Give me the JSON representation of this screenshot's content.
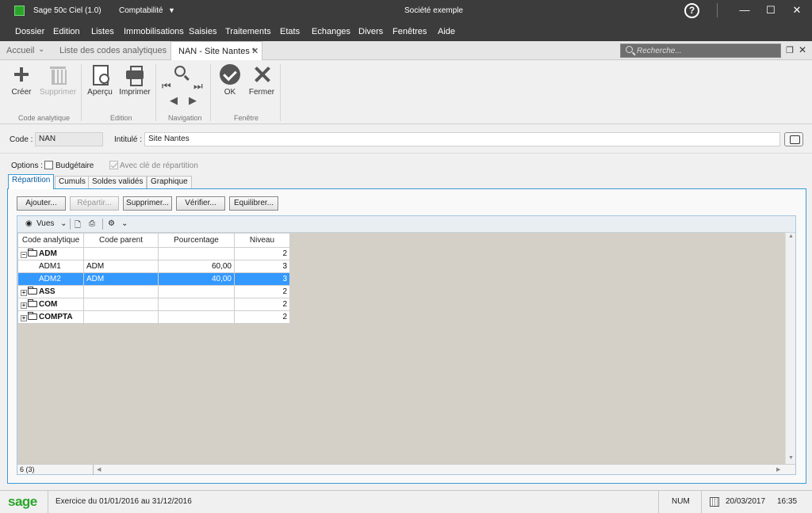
{
  "titlebar": {
    "app_name": "Sage 50c Ciel (1.0)",
    "module": "Comptabilité",
    "company": "Société exemple",
    "help_label": "?",
    "min_label": "—",
    "max_label": "☐",
    "close_label": "✕"
  },
  "menu": [
    "Dossier",
    "Edition",
    "Listes",
    "Immobilisations",
    "Saisies",
    "Traitements",
    "Etats",
    "Echanges",
    "Divers",
    "Fenêtres",
    "Aide"
  ],
  "tabs": {
    "home": "Accueil",
    "list": "Liste des codes analytiques",
    "active": "NAN - Site Nantes *",
    "search_placeholder": "Recherche..."
  },
  "ribbon": {
    "create": "Créer",
    "delete": "Supprimer",
    "preview": "Aperçu",
    "print": "Imprimer",
    "ok": "OK",
    "close": "Fermer",
    "group_code": "Code analytique",
    "group_edition": "Edition",
    "group_navigation": "Navigation",
    "group_window": "Fenêtre"
  },
  "form": {
    "code_label": "Code :",
    "code_value": "NAN",
    "title_label": "Intitulé :",
    "title_value": "Site Nantes",
    "options_label": "Options :",
    "budgetaire_label": "Budgétaire",
    "budgetaire_checked": false,
    "repartition_label": "Avec clé de répartition",
    "repartition_checked": true
  },
  "subtabs": [
    "Répartition",
    "Cumuls",
    "Soldes validés",
    "Graphique"
  ],
  "actions": {
    "add": "Ajouter...",
    "split": "Répartir...",
    "delete": "Supprimer...",
    "check": "Vérifier...",
    "balance": "Equilibrer..."
  },
  "grid": {
    "views_label": "Vues",
    "columns": [
      "Code analytique",
      "Code parent",
      "Pourcentage",
      "Niveau"
    ],
    "rows": [
      {
        "code": "ADM",
        "parent": "",
        "pct": "",
        "level": "2",
        "group": true,
        "expander": "⊟",
        "selected": false
      },
      {
        "code": "ADM1",
        "parent": "ADM",
        "pct": "60,00",
        "level": "3",
        "group": false,
        "expander": "",
        "selected": false
      },
      {
        "code": "ADM2",
        "parent": "ADM",
        "pct": "40,00",
        "level": "3",
        "group": false,
        "expander": "",
        "selected": true
      },
      {
        "code": "ASS",
        "parent": "",
        "pct": "",
        "level": "2",
        "group": true,
        "expander": "⊞",
        "selected": false
      },
      {
        "code": "COM",
        "parent": "",
        "pct": "",
        "level": "2",
        "group": true,
        "expander": "⊞",
        "selected": false
      },
      {
        "code": "COMPTA",
        "parent": "",
        "pct": "",
        "level": "2",
        "group": true,
        "expander": "⊞",
        "selected": false
      }
    ],
    "count": "6 (3)"
  },
  "statusbar": {
    "logo": "sage",
    "exercise": "Exercice du 01/01/2016 au 31/12/2016",
    "num": "NUM",
    "date": "20/03/2017",
    "time": "16:35"
  }
}
